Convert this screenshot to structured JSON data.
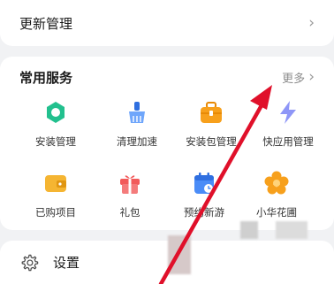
{
  "update_row": {
    "label": "更新管理"
  },
  "services": {
    "title": "常用服务",
    "more": "更多",
    "items": [
      {
        "label": "安装管理",
        "icon": "install-manager-icon",
        "color": "#22c08e"
      },
      {
        "label": "清理加速",
        "icon": "broom-icon",
        "color": "#4a8cf7"
      },
      {
        "label": "安装包管理",
        "icon": "briefcase-icon",
        "color": "#f7a01c"
      },
      {
        "label": "快应用管理",
        "icon": "lightning-icon",
        "color": "#7d86f5"
      },
      {
        "label": "已购项目",
        "icon": "wallet-icon",
        "color": "#f5b532"
      },
      {
        "label": "礼包",
        "icon": "gift-icon",
        "color": "#f25a5a"
      },
      {
        "label": "预约新游",
        "icon": "calendar-icon",
        "color": "#4a8cf7"
      },
      {
        "label": "小华花圃",
        "icon": "flower-icon",
        "color": "#f7a01c"
      }
    ]
  },
  "settings_row": {
    "label": "设置",
    "icon": "gear-icon"
  },
  "colors": {
    "background": "#f1f2f4",
    "card": "#ffffff",
    "annotation": "#e0102a"
  }
}
